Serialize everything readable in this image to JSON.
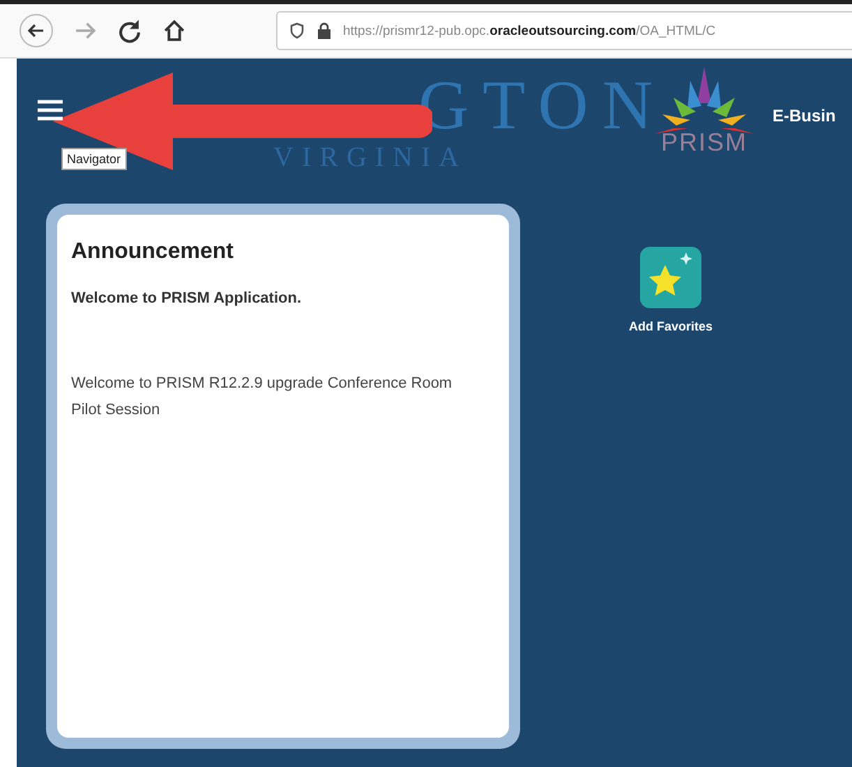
{
  "browser": {
    "url_prefix": "https://prismr12-pub.opc.",
    "url_domain": "oracleoutsourcing.com",
    "url_path": "/OA_HTML/C"
  },
  "header": {
    "logo_title": "GTON",
    "logo_subtitle": "VIRGINIA",
    "brand": "PRISM",
    "app_title": "E-Busin",
    "tooltip": "Navigator"
  },
  "announcement": {
    "title": "Announcement",
    "headline": "Welcome to PRISM Application.",
    "body": "Welcome to PRISM R12.2.9 upgrade Conference Room Pilot Session"
  },
  "favorites": {
    "label": "Add Favorites"
  }
}
